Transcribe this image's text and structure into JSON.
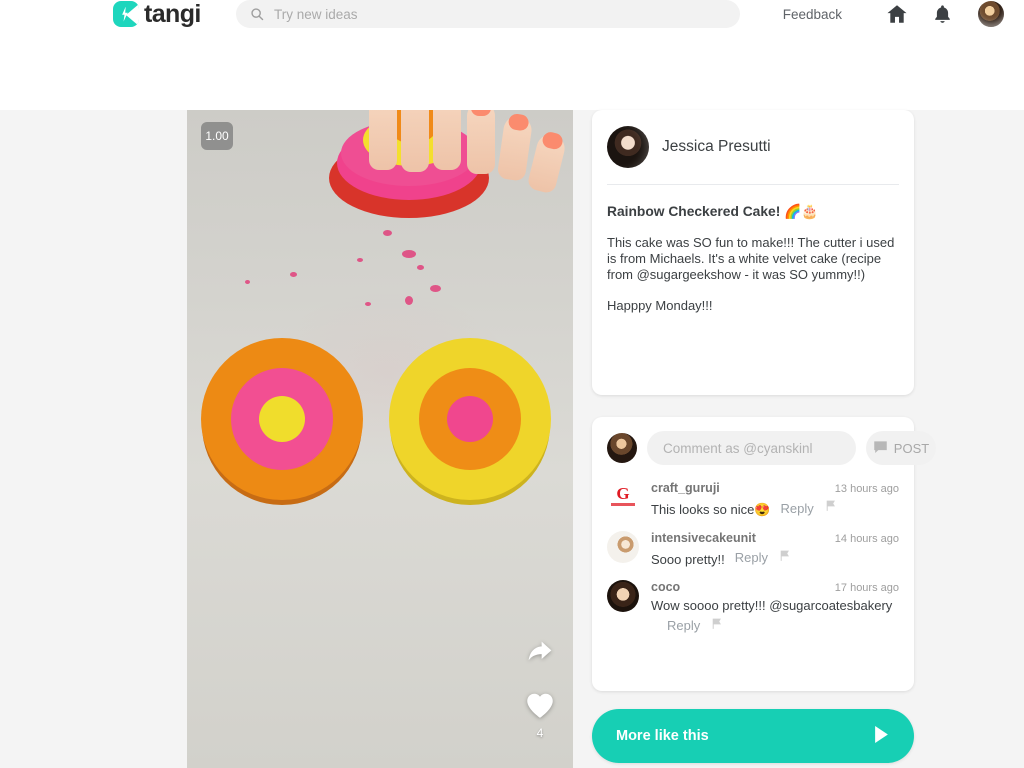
{
  "header": {
    "logo_text": "tangi",
    "logo_icon": "tangi-play-bolt-icon",
    "search": {
      "icon": "search-icon",
      "placeholder": "Try new ideas",
      "value": ""
    },
    "feedback_label": "Feedback",
    "home_icon": "home-icon",
    "bell_icon": "notification-bell-icon",
    "avatar": "user-avatar"
  },
  "video": {
    "speed_badge": "1.00",
    "share_icon": "share-icon",
    "like_icon": "heart-icon",
    "like_count": "4"
  },
  "post": {
    "author_name": "Jessica Presutti",
    "author_avatar": "author-avatar",
    "title": "Rainbow Checkered Cake! 🌈🎂",
    "description": "This cake was SO fun to make!!! The cutter i used is from Michaels. It's a white velvet cake (recipe from @sugargeekshow - it was SO yummy!!)\n\nHapppy Monday!!!"
  },
  "comments": {
    "compose": {
      "avatar": "current-user-avatar",
      "placeholder": "Comment as @cyanskinl",
      "value": "",
      "post_label": "POST",
      "post_icon": "comment-bubble-icon"
    },
    "reply_label": "Reply",
    "flag_icon": "flag-icon",
    "items": [
      {
        "username": "craft_guruji",
        "time": "13 hours ago",
        "text": "This looks so nice😍",
        "avatar": "craft-guruji-avatar"
      },
      {
        "username": "intensivecakeunit",
        "time": "14 hours ago",
        "text": "Sooo pretty!!",
        "avatar": "intensivecakeunit-avatar"
      },
      {
        "username": "coco",
        "time": "17 hours ago",
        "text": "Wow soooo pretty!!! @sugarcoatesbakery",
        "avatar": "coco-avatar"
      }
    ]
  },
  "more_like_this": {
    "label": "More like this",
    "arrow_icon": "play-arrow-icon"
  },
  "colors": {
    "brand_teal": "#17cfb4",
    "logo_teal": "#1ed6bd",
    "page_bg": "#f4f4f4",
    "card_bg": "#ffffff",
    "text_primary": "#3c4043",
    "text_muted": "#9aa0a6"
  }
}
